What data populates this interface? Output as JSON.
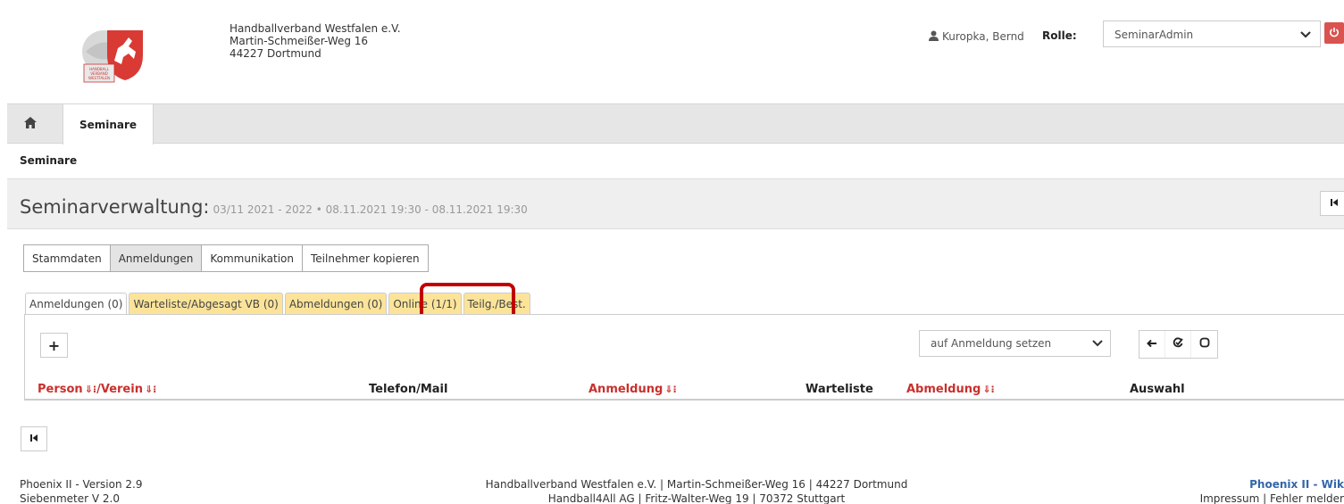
{
  "header": {
    "org_name": "Handballverband Westfalen e.V.",
    "org_street": "Martin-Schmeißer-Weg 16",
    "org_city": "44227 Dortmund",
    "logo_text_1": "HANDBALL",
    "logo_text_2": "VERBAND",
    "logo_text_3": "WESTFALEN",
    "user_name": "Kuropka, Bernd",
    "role_label": "Rolle:",
    "role_value": "SeminarAdmin"
  },
  "navbar": {
    "home_icon": "home-icon",
    "active_tab": "Seminare"
  },
  "breadcrumb": "Seminare",
  "title": {
    "main": "Seminarverwaltung:",
    "sub": "03/11 2021 - 2022 • 08.11.2021 19:30 - 08.11.2021 19:30"
  },
  "main_tabs": [
    "Stammdaten",
    "Anmeldungen",
    "Kommunikation",
    "Teilnehmer kopieren"
  ],
  "sub_tabs": [
    "Anmeldungen (0)",
    "Warteliste/Abgesagt VB (0)",
    "Abmeldungen (0)",
    "Online (1/1)",
    "Teilg./Best."
  ],
  "toolbar": {
    "add_label": "+",
    "action_value": "auf Anmeldung setzen"
  },
  "columns": {
    "person": "Person",
    "verein": "/Verein",
    "telefon": "Telefon/Mail",
    "anmeldung": "Anmeldung",
    "warteliste": "Warteliste",
    "abmeldung": "Abmeldung",
    "auswahl": "Auswahl",
    "sort_glyph": "⇓⁝"
  },
  "footer": {
    "version": "Phoenix II - Version 2.9",
    "siebenmeter": "Siebenmeter V 2.0",
    "address_1": "Handballverband Westfalen e.V. | Martin-Schmeißer-Weg 16 | 44227 Dortmund",
    "address_2": "Handball4All AG | Fritz-Walter-Weg 19 | 70372 Stuttgart",
    "wiki": "Phoenix II - Wik",
    "links": "Impressum | Fehler melder"
  },
  "colors": {
    "accent_red": "#c9302c",
    "tab_yellow": "#fbe49a",
    "highlight": "#c00000"
  }
}
